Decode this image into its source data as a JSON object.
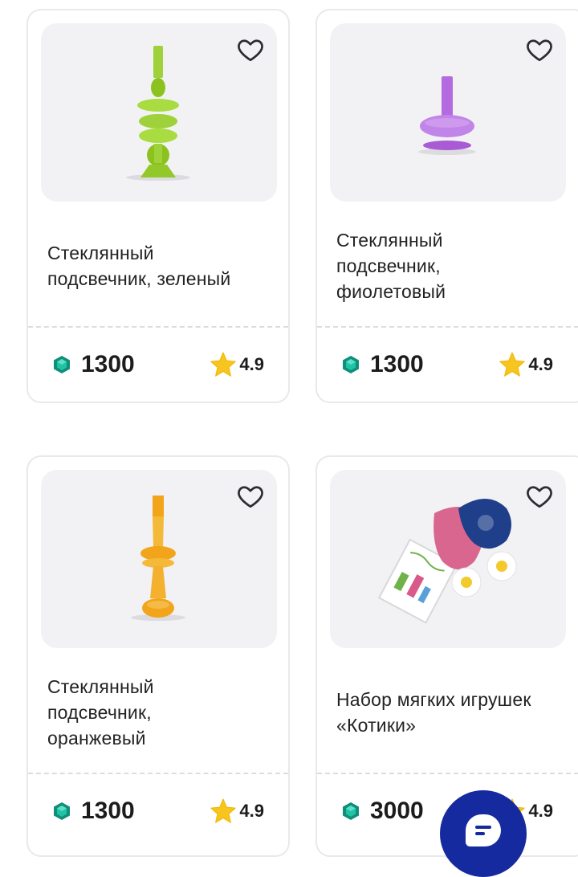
{
  "products": [
    {
      "title_line1": "Стеклянный",
      "title_line2": "подсвечник, зеленый",
      "title_line3": "",
      "price": "1300",
      "rating": "4.9",
      "image": "green-glass-candlestick",
      "favorite_icon": "heart-outline-icon"
    },
    {
      "title_line1": "Стеклянный",
      "title_line2": "подсвечник,",
      "title_line3": "фиолетовый",
      "price": "1300",
      "rating": "4.9",
      "image": "purple-glass-candlestick",
      "favorite_icon": "heart-outline-icon"
    },
    {
      "title_line1": "Стеклянный",
      "title_line2": "подсвечник,",
      "title_line3": "оранжевый",
      "price": "1300",
      "rating": "4.9",
      "image": "orange-glass-candlestick",
      "favorite_icon": "heart-outline-icon"
    },
    {
      "title_line1": "Набор мягких игрушек",
      "title_line2": "«Котики»",
      "title_line3": "",
      "price": "3000",
      "rating": "4.9",
      "image": "soft-toy-cats-set",
      "favorite_icon": "heart-outline-icon"
    }
  ],
  "icons": {
    "currency": "green-gem-icon",
    "rating": "star-icon",
    "chat": "chat-bubble-icon"
  },
  "colors": {
    "gem": "#15b39a",
    "star": "#f7c520",
    "chat_button": "#162aa0",
    "green_glass": "#9fd23a",
    "purple_glass": "#b56be0",
    "orange_glass": "#f2b431"
  }
}
